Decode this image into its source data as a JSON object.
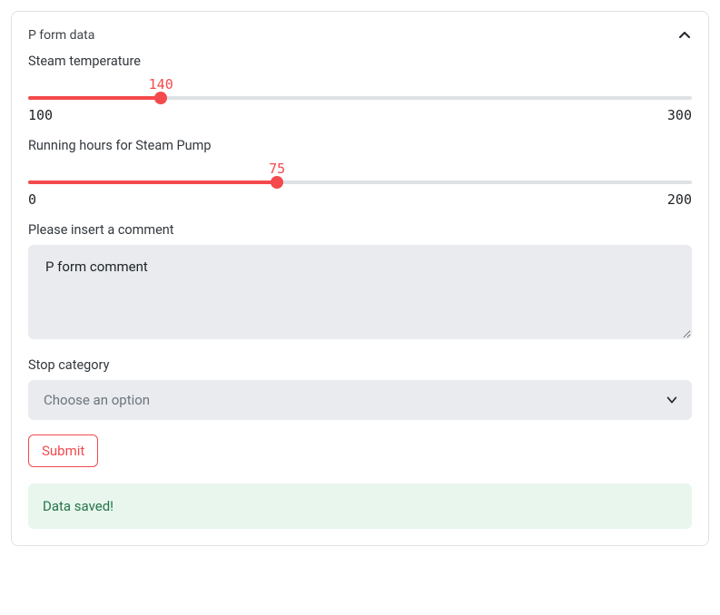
{
  "header": {
    "title": "P form data"
  },
  "sliders": {
    "steam_temp": {
      "label": "Steam temperature",
      "value": 140,
      "min": 100,
      "max": 300,
      "percent": 20
    },
    "running_hours": {
      "label": "Running hours for Steam Pump",
      "value": 75,
      "min": 0,
      "max": 200,
      "percent": 37.5
    }
  },
  "comment": {
    "label": "Please insert a comment",
    "value": "P form comment"
  },
  "stop_category": {
    "label": "Stop category",
    "placeholder": "Choose an option"
  },
  "submit": {
    "label": "Submit"
  },
  "alert": {
    "message": "Data saved!"
  }
}
